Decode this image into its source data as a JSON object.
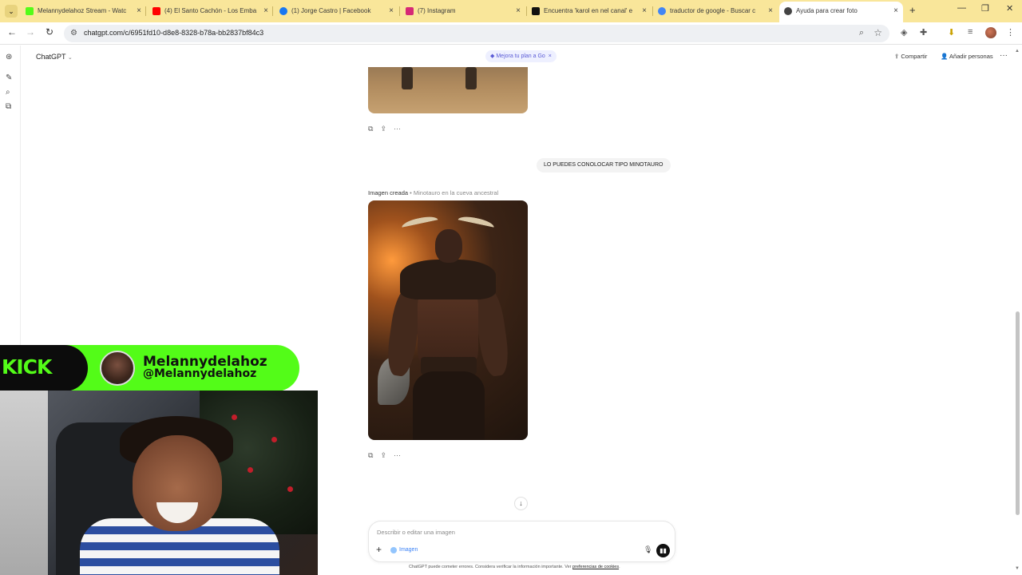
{
  "browser": {
    "tabs": [
      {
        "title": "Melannydelahoz Stream - Watc",
        "favicon_color": "#53fc18"
      },
      {
        "title": "(4) El Santo Cachón - Los Emba",
        "favicon_color": "#ff0000"
      },
      {
        "title": "(1) Jorge Castro | Facebook",
        "favicon_color": "#1877f2"
      },
      {
        "title": "(7) Instagram",
        "favicon_color": "#d62976"
      },
      {
        "title": "Encuentra 'karol en nel canal' e",
        "favicon_color": "#111111"
      },
      {
        "title": "traductor de google - Buscar c",
        "favicon_color": "#4285f4"
      },
      {
        "title": "Ayuda para crear foto",
        "favicon_color": "#444444",
        "active": true
      }
    ],
    "url": "chatgpt.com/c/6951fd10-d8e8-8328-b78a-bb2837bf84c3"
  },
  "app": {
    "name": "ChatGPT",
    "upgrade_label": "Mejora tu plan a Go",
    "share_label": "Compartir",
    "add_people_label": "Añadir personas"
  },
  "conversation": {
    "user_message": "LO PUEDES CONOLOCAR TIPO MINOTAURO",
    "image_caption_bold": "Imagen creada",
    "image_caption_title": "Minotauro en la cueva ancestral"
  },
  "composer": {
    "placeholder": "Describir o editar una imagen",
    "chip_label": "Imagen",
    "disclaimer": "ChatGPT puede cometer errores. Considera verificar la información importante. Ver",
    "disclaimer_link": "preferencias de cookies",
    "disclaimer_end": "."
  },
  "stream_overlay": {
    "platform": "KICK",
    "display_name": "Melannydelahoz",
    "handle": "@Melannydelahoz",
    "accent": "#53fc18"
  },
  "icons": [
    "tab-search-icon",
    "close-icon",
    "back-icon",
    "forward-icon",
    "reload-icon",
    "site-info-icon",
    "zoom-icon",
    "bookmark-star-icon",
    "new-chat-icon",
    "search-icon",
    "library-icon",
    "copy-icon",
    "share-icon",
    "more-icon",
    "arrow-down-icon",
    "plus-icon",
    "mic-icon",
    "voice-mode-icon"
  ]
}
